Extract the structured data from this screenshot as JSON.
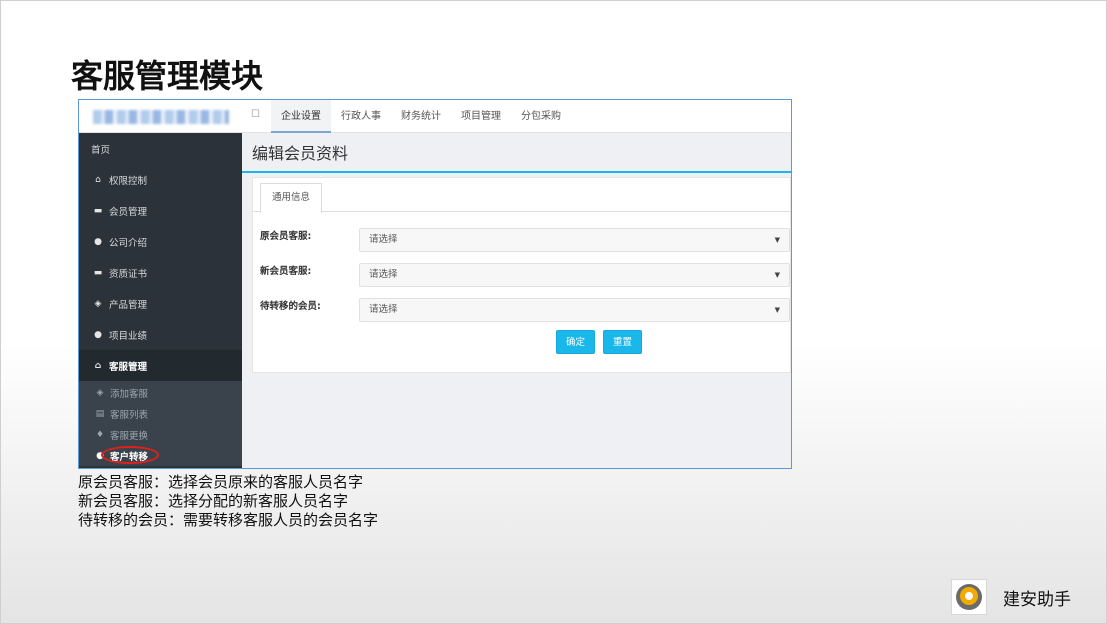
{
  "slide": {
    "title": "客服管理模块",
    "notes": [
      "原会员客服：选择会员原来的客服人员名字",
      "新会员客服：选择分配的新客服人员名字",
      "待转移的会员：需要转移客服人员的会员名字"
    ],
    "brand_name": "建安助手"
  },
  "app": {
    "menu_toggle_icon": "square-menu-icon",
    "nav": [
      {
        "label": "企业设置",
        "active": true
      },
      {
        "label": "行政人事",
        "active": false
      },
      {
        "label": "财务统计",
        "active": false
      },
      {
        "label": "项目管理",
        "active": false
      },
      {
        "label": "分包采购",
        "active": false
      }
    ],
    "sidebar": {
      "home": "首页",
      "items": [
        {
          "label": "权限控制",
          "icon": "home-icon"
        },
        {
          "label": "会员管理",
          "icon": "comment-icon"
        },
        {
          "label": "公司介绍",
          "icon": "lightbulb-icon"
        },
        {
          "label": "资质证书",
          "icon": "comment-icon"
        },
        {
          "label": "产品管理",
          "icon": "tag-icon"
        },
        {
          "label": "项目业绩",
          "icon": "lightbulb-icon"
        },
        {
          "label": "客服管理",
          "icon": "home-icon",
          "active": true
        }
      ],
      "sub_items": [
        {
          "label": "添加客服",
          "icon": "tag-icon"
        },
        {
          "label": "客服列表",
          "icon": "list-icon"
        },
        {
          "label": "客服更换",
          "icon": "flame-icon"
        },
        {
          "label": "客户转移",
          "icon": "lightbulb-icon",
          "current": true
        }
      ]
    },
    "page_title": "编辑会员资料",
    "tab": "通用信息",
    "form": [
      {
        "label": "原会员客服:",
        "value": "请选择"
      },
      {
        "label": "新会员客服:",
        "value": "请选择"
      },
      {
        "label": "待转移的会员:",
        "value": "请选择"
      }
    ],
    "buttons": {
      "confirm": "确定",
      "reset": "重置"
    }
  }
}
